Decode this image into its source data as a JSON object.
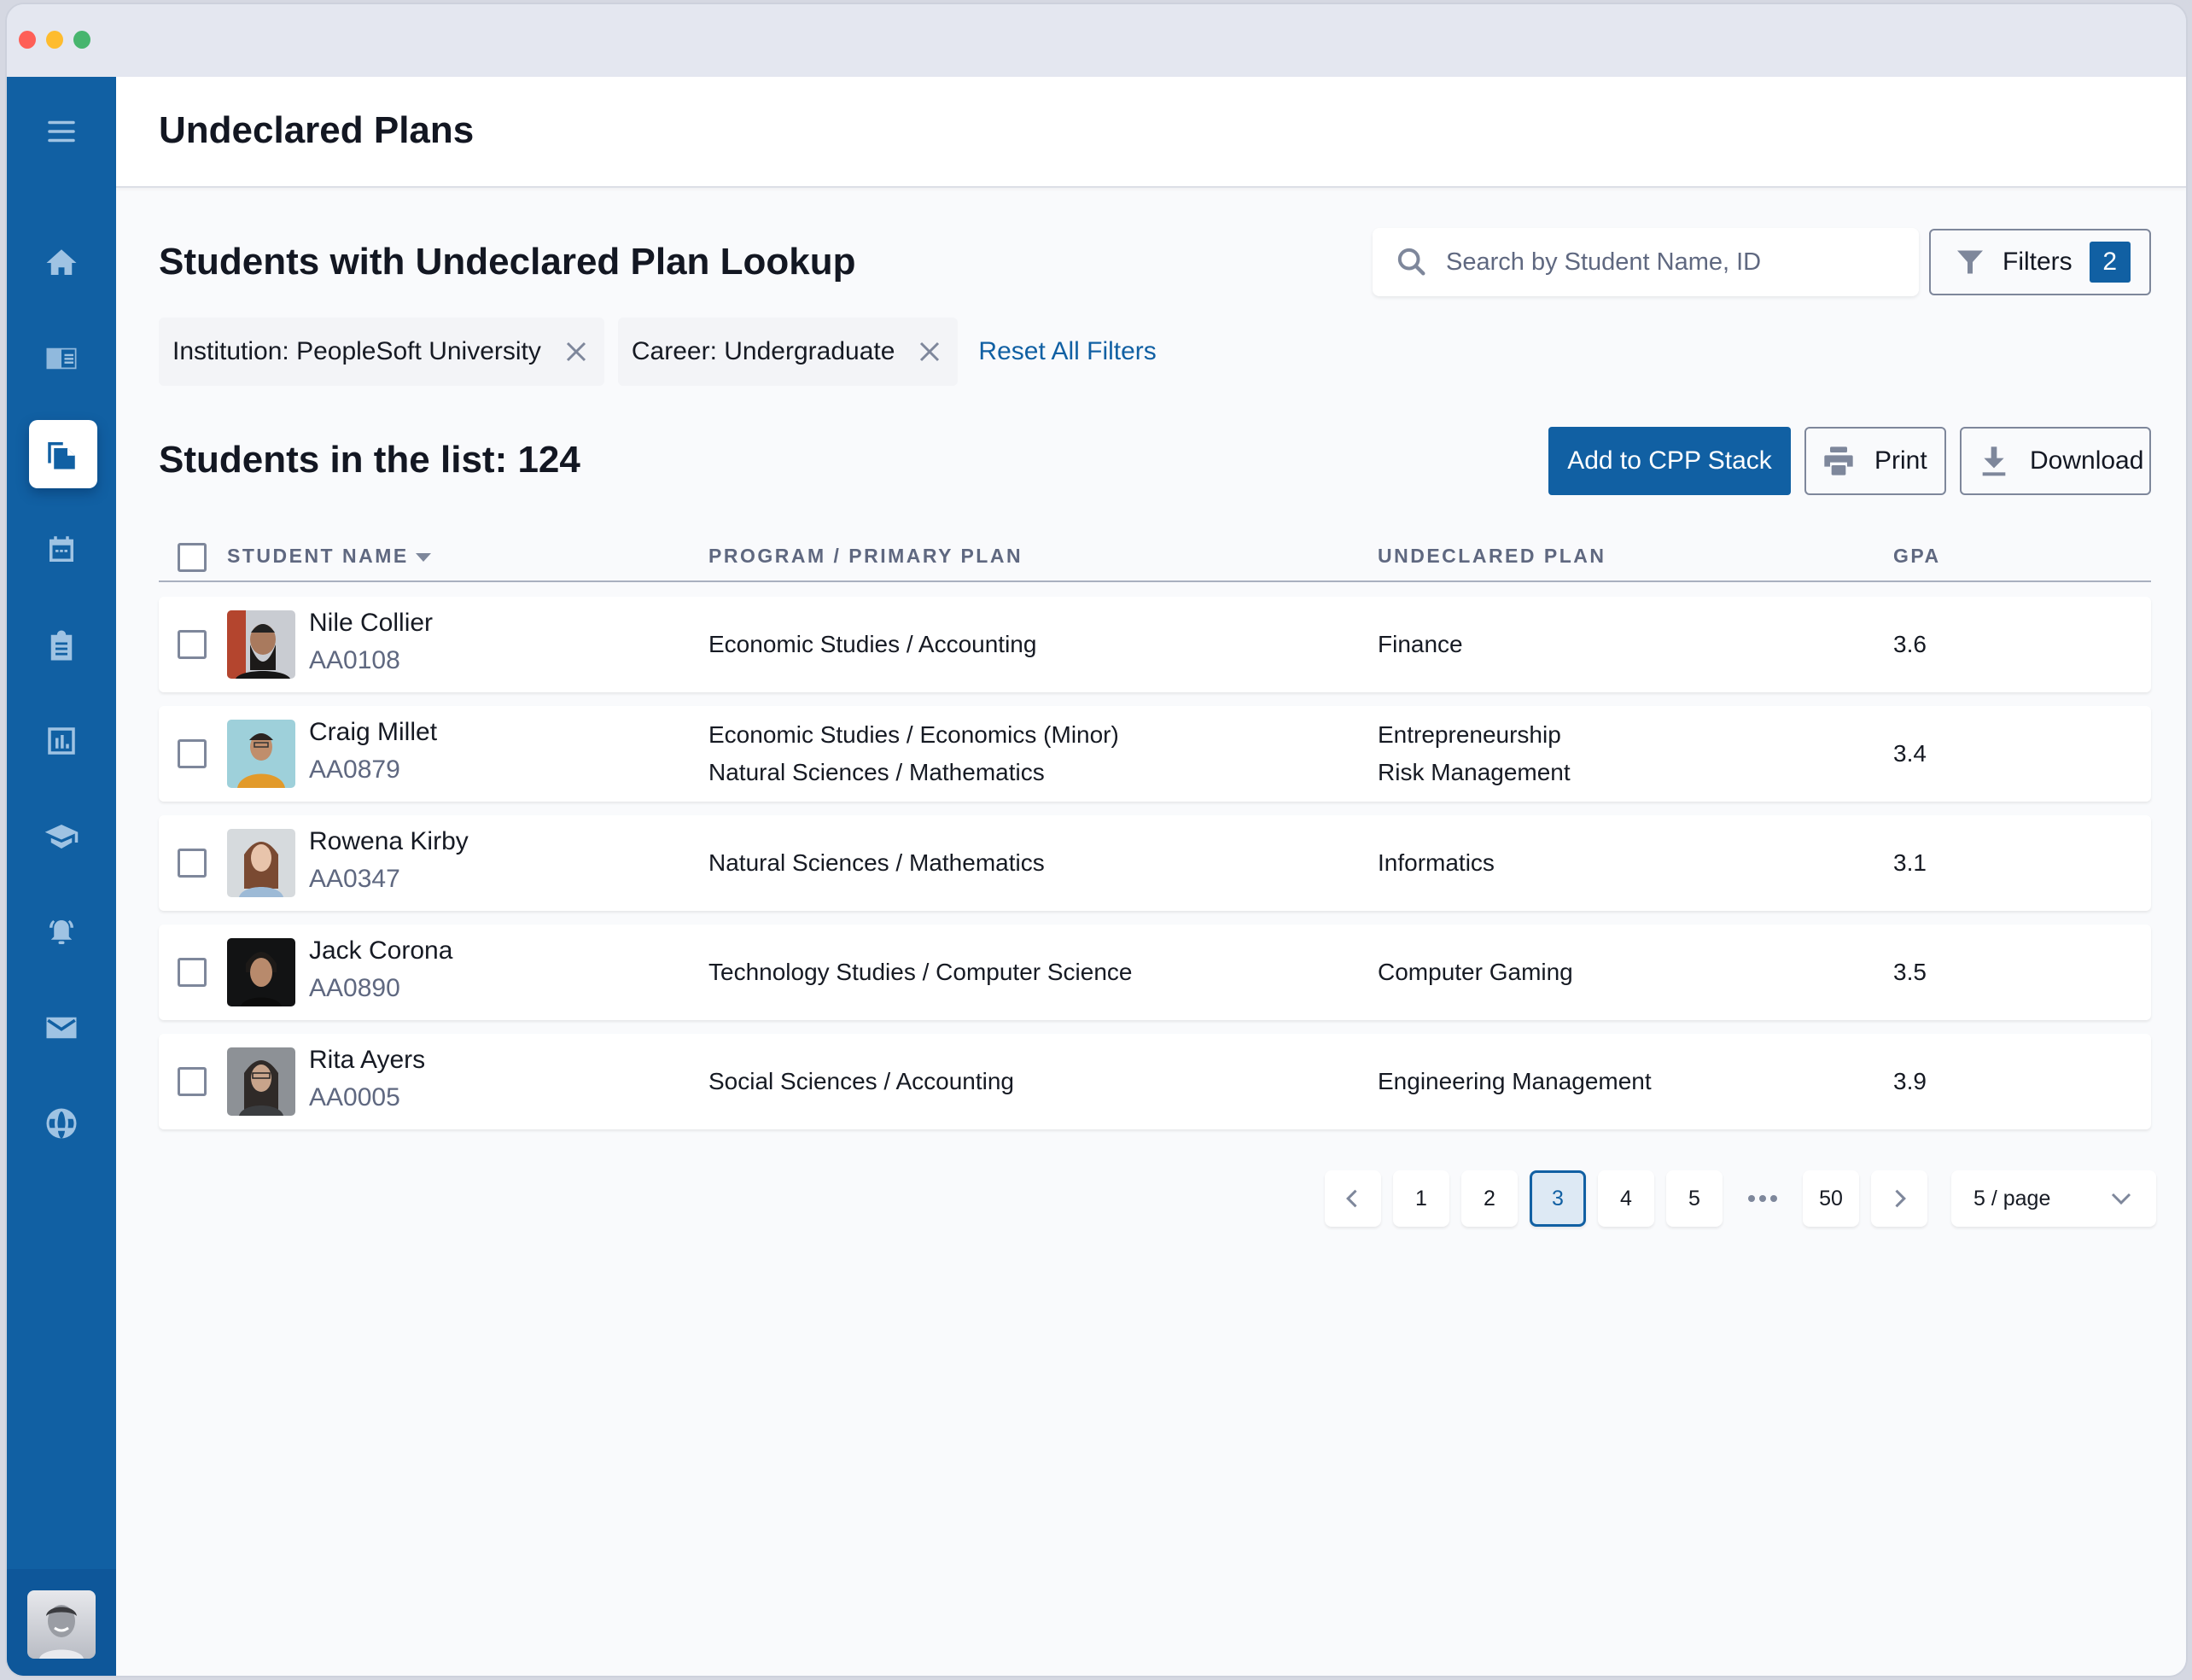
{
  "window": {
    "traffic_lights": [
      "close",
      "minimize",
      "maximize"
    ]
  },
  "sidebar": {
    "menu_icon": "hamburger-menu-icon",
    "items": [
      {
        "name": "home",
        "icon": "home-icon",
        "active": false
      },
      {
        "name": "catalog",
        "icon": "catalog-icon",
        "active": false
      },
      {
        "name": "documents",
        "icon": "documents-icon",
        "active": true
      },
      {
        "name": "calendar",
        "icon": "calendar-icon",
        "active": false
      },
      {
        "name": "clipboard",
        "icon": "clipboard-icon",
        "active": false
      },
      {
        "name": "reports",
        "icon": "bar-chart-icon",
        "active": false
      },
      {
        "name": "academics",
        "icon": "graduation-cap-icon",
        "active": false
      },
      {
        "name": "alerts",
        "icon": "bell-ringing-icon",
        "active": false
      },
      {
        "name": "messages",
        "icon": "envelope-icon",
        "active": false
      },
      {
        "name": "global",
        "icon": "globe-icon",
        "active": false
      }
    ],
    "user_avatar": "user-avatar"
  },
  "header": {
    "title": "Undeclared Plans"
  },
  "lookup": {
    "title": "Students with Undeclared Plan Lookup",
    "search_placeholder": "Search by Student Name, ID",
    "search_value": "",
    "filters_label": "Filters",
    "filters_count": "2"
  },
  "active_filters": {
    "chips": [
      {
        "label": "Institution: PeopleSoft University"
      },
      {
        "label": "Career: Undergraduate"
      }
    ],
    "reset_label": "Reset All Filters"
  },
  "list": {
    "count_title": "Students in the list: 124",
    "actions": {
      "add_label": "Add to CPP Stack",
      "print_label": "Print",
      "download_label": "Download"
    },
    "columns": [
      "STUDENT NAME",
      "PROGRAM / PRIMARY PLAN",
      "UNDECLARED PLAN",
      "GPA"
    ],
    "sort_column": "STUDENT NAME",
    "rows": [
      {
        "name": "Nile Collier",
        "id": "AA0108",
        "program": [
          "Economic Studies / Accounting"
        ],
        "undeclared": [
          "Finance"
        ],
        "gpa": "3.6"
      },
      {
        "name": "Craig Millet",
        "id": "AA0879",
        "program": [
          "Economic Studies / Economics (Minor)",
          "Natural Sciences / Mathematics"
        ],
        "undeclared": [
          "Entrepreneurship",
          "Risk Management"
        ],
        "gpa": "3.4"
      },
      {
        "name": "Rowena Kirby",
        "id": "AA0347",
        "program": [
          "Natural Sciences / Mathematics"
        ],
        "undeclared": [
          "Informatics"
        ],
        "gpa": "3.1"
      },
      {
        "name": "Jack Corona",
        "id": "AA0890",
        "program": [
          "Technology Studies / Computer Science"
        ],
        "undeclared": [
          "Computer Gaming"
        ],
        "gpa": "3.5"
      },
      {
        "name": "Rita Ayers",
        "id": "AA0005",
        "program": [
          "Social Sciences / Accounting"
        ],
        "undeclared": [
          "Engineering Management"
        ],
        "gpa": "3.9"
      }
    ]
  },
  "pagination": {
    "pages": [
      "1",
      "2",
      "3",
      "4",
      "5"
    ],
    "last_page": "50",
    "current_page": "3",
    "per_page": "5 / page"
  },
  "colors": {
    "brand": "#1160a3",
    "sidebar_icon": "#9fc3e3",
    "muted_text": "#5f6880"
  }
}
